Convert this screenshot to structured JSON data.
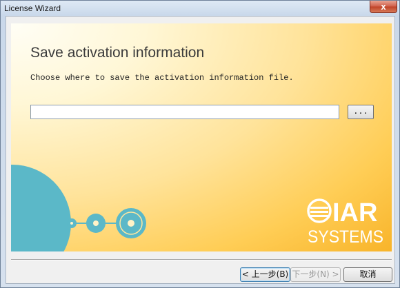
{
  "window": {
    "title": "License Wizard",
    "close_glyph": "x"
  },
  "page": {
    "heading": "Save activation information",
    "description": "Choose where to save the activation information file.",
    "path_value": "",
    "browse_label": "..."
  },
  "logo": {
    "line1": "IAR",
    "line2": "SYSTEMS"
  },
  "buttons": {
    "back": "< 上一步(B)",
    "next": "下一步(N) >",
    "cancel": "取消"
  },
  "colors": {
    "banner_accent": "#f8b42a",
    "decoration": "#5bb8c8",
    "logo": "#ffffff"
  },
  "icons": [
    "close-icon",
    "disc-decoration",
    "iar-logo-icon"
  ]
}
